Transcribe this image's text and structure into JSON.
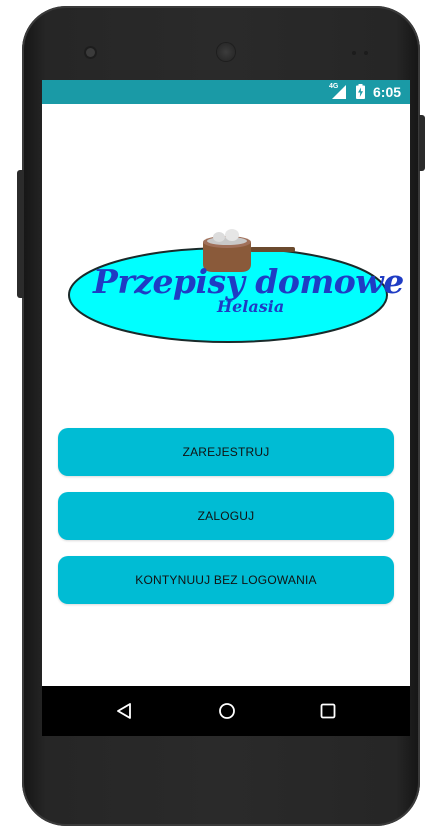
{
  "status_bar": {
    "network": "4G",
    "time": "6:05",
    "color": "#1a9aa6"
  },
  "logo": {
    "title": "Przepisy domowe",
    "subtitle": "Helasia",
    "ellipse_color": "#00ffff",
    "text_color": "#1f3cc4"
  },
  "buttons": {
    "register_label": "ZAREJESTRUJ",
    "login_label": "ZALOGUJ",
    "continue_label": "KONTYNUUJ BEZ LOGOWANIA",
    "color": "#00bcd4"
  },
  "nav_bar": {
    "icons": [
      "back-icon",
      "home-icon",
      "recent-apps-icon"
    ]
  }
}
